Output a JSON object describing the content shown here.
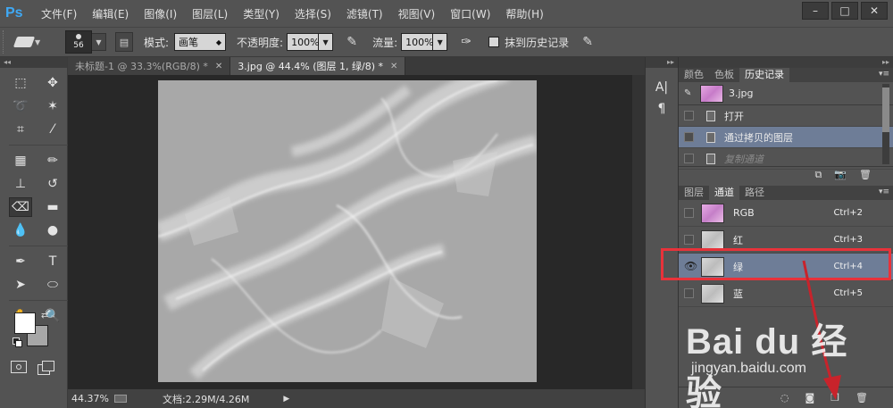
{
  "app": {
    "logo": "Ps",
    "menu": [
      "文件(F)",
      "编辑(E)",
      "图像(I)",
      "图层(L)",
      "类型(Y)",
      "选择(S)",
      "滤镜(T)",
      "视图(V)",
      "窗口(W)",
      "帮助(H)"
    ],
    "window_buttons": [
      "–",
      "□",
      "✕"
    ]
  },
  "options_bar": {
    "brush_size": "56",
    "mode_label": "模式:",
    "mode_value": "画笔",
    "opacity_label": "不透明度:",
    "opacity_value": "100%",
    "flow_label": "流量:",
    "flow_value": "100%",
    "history_label": "抹到历史记录"
  },
  "documents": {
    "tabs": [
      {
        "label": "未标题-1 @ 33.3%(RGB/8) *",
        "active": false
      },
      {
        "label": "3.jpg @ 44.4% (图层 1, 绿/8) *",
        "active": true
      }
    ]
  },
  "status": {
    "zoom": "44.37%",
    "doc_size": "文档:2.29M/4.26M"
  },
  "history_panel": {
    "tabs": [
      "颜色",
      "色板",
      "历史记录"
    ],
    "active_tab": 2,
    "snapshot": "3.jpg",
    "items": [
      {
        "label": "打开",
        "state": "normal"
      },
      {
        "label": "通过拷贝的图层",
        "state": "active"
      },
      {
        "label": "复制通道",
        "state": "dim"
      }
    ]
  },
  "channels_panel": {
    "tabs": [
      "图层",
      "通道",
      "路径"
    ],
    "active_tab": 1,
    "channels": [
      {
        "name": "RGB",
        "shortcut": "Ctrl+2",
        "visible": false,
        "active": false,
        "thumb": "rgb"
      },
      {
        "name": "红",
        "shortcut": "Ctrl+3",
        "visible": false,
        "active": false,
        "thumb": "gray"
      },
      {
        "name": "绿",
        "shortcut": "Ctrl+4",
        "visible": true,
        "active": true,
        "thumb": "gray"
      },
      {
        "name": "蓝",
        "shortcut": "Ctrl+5",
        "visible": false,
        "active": false,
        "thumb": "gray"
      }
    ]
  },
  "watermark": {
    "main": "Bai du 经验",
    "sub": "jingyan.baidu.com"
  },
  "colors": {
    "foreground": "#ffffff",
    "background": "#a7a7a7",
    "highlight": "#e8323a",
    "selection": "#6e7d97"
  }
}
